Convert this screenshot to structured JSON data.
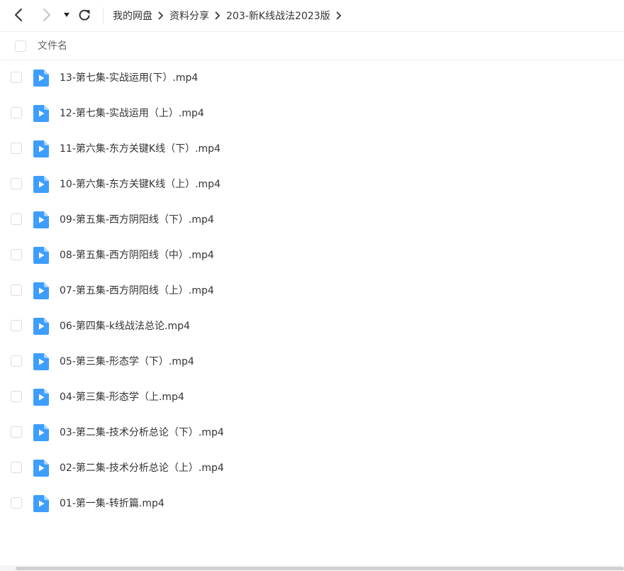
{
  "toolbar": {
    "back_icon": "chevron-left-icon",
    "forward_icon": "chevron-right-icon",
    "history_dropdown_icon": "caret-down-icon",
    "refresh_icon": "refresh-icon"
  },
  "breadcrumb": {
    "items": [
      "我的网盘",
      "资料分享",
      "203-新K线战法2023版"
    ]
  },
  "list_header": {
    "name_label": "文件名"
  },
  "colors": {
    "icon_blue": "#3d9eff",
    "icon_blue_fold": "#a8d3ff"
  },
  "files": [
    {
      "name": "13-第七集-实战运用(下）.mp4",
      "icon": "video-file-icon"
    },
    {
      "name": "12-第七集-实战运用（上）.mp4",
      "icon": "video-file-icon"
    },
    {
      "name": "11-第六集-东方关键K线（下）.mp4",
      "icon": "video-file-icon"
    },
    {
      "name": "10-第六集-东方关键K线（上）.mp4",
      "icon": "video-file-icon"
    },
    {
      "name": "09-第五集-西方阴阳线（下）.mp4",
      "icon": "video-file-icon"
    },
    {
      "name": "08-第五集-西方阴阳线（中）.mp4",
      "icon": "video-file-icon"
    },
    {
      "name": "07-第五集-西方阴阳线（上）.mp4",
      "icon": "video-file-icon"
    },
    {
      "name": "06-第四集-k线战法总论.mp4",
      "icon": "video-file-icon"
    },
    {
      "name": "05-第三集-形态学（下）.mp4",
      "icon": "video-file-icon"
    },
    {
      "name": "04-第三集-形态学（上.mp4",
      "icon": "video-file-icon"
    },
    {
      "name": "03-第二集-技术分析总论（下）.mp4",
      "icon": "video-file-icon"
    },
    {
      "name": "02-第二集-技术分析总论（上）.mp4",
      "icon": "video-file-icon"
    },
    {
      "name": "01-第一集-转折篇.mp4",
      "icon": "video-file-icon"
    }
  ]
}
